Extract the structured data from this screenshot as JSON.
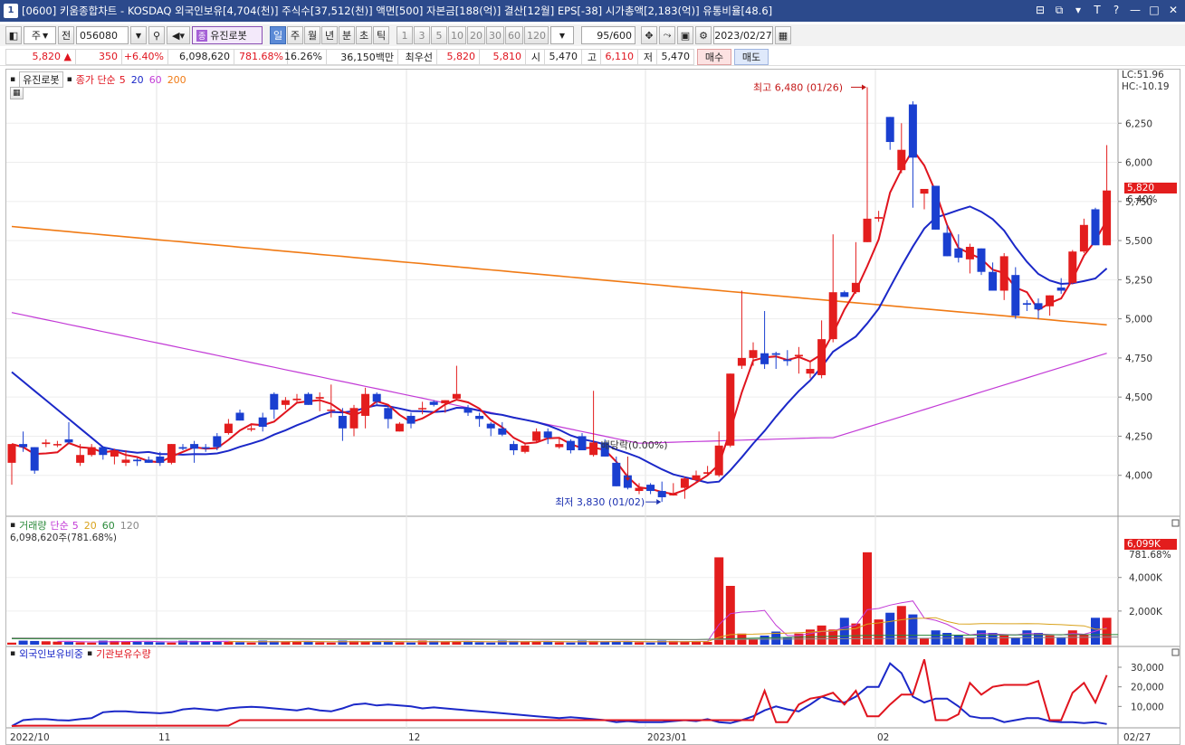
{
  "window": {
    "screen_id": "1",
    "title": "[0600] 키움종합차트 - KOSDAQ 외국인보유[4,704(천)] 주식수[37,512(천)] 액면[500] 자본금[188(억)] 결산[12월] EPS[-38] 시가총액[2,183(억)] 유통비율[48.6]",
    "buttons": [
      "⊟",
      "⧉",
      "▾",
      "T",
      "?",
      "—",
      "□",
      "✕"
    ]
  },
  "toolbar": {
    "period_select": "주",
    "prev_label": "전",
    "code": "056080",
    "stock_name_badge": "종",
    "stock_name": "유진로봇",
    "period_tabs": [
      "일",
      "주",
      "월",
      "년",
      "분",
      "초",
      "틱"
    ],
    "active_period": "일",
    "intervals": [
      "1",
      "3",
      "5",
      "10",
      "20",
      "30",
      "60",
      "120"
    ],
    "count": "95",
    "count_total": "/600",
    "date": "2023/02/27"
  },
  "quote": {
    "price": "5,820",
    "arrow": "▲",
    "change": "350",
    "change_pct": "+6.40%",
    "volume": "6,098,620",
    "volume_pct": "781.68%",
    "turnover": "16.26%",
    "amount": "36,150백만",
    "best_label": "최우선",
    "ask": "5,820",
    "bid": "5,810",
    "open_label": "시",
    "open": "5,470",
    "high_label": "고",
    "high": "6,110",
    "low_label": "저",
    "low": "5,470",
    "buy_label": "매수",
    "sell_label": "매도"
  },
  "price_panel": {
    "stock_label": "유진로봇",
    "ma_label": "종가 단순",
    "ma_periods": [
      "5",
      "20",
      "60",
      "200"
    ],
    "ma_colors": [
      "#e0141e",
      "#1b28c8",
      "#c23ad6",
      "#f07a14"
    ],
    "lc": "LC:51.96",
    "hc": "HC:-10.19",
    "y_ticks": [
      "6,250",
      "6,000",
      "5,750",
      "5,500",
      "5,250",
      "5,000",
      "4,750",
      "4,500",
      "4,250",
      "4,000"
    ],
    "current_price": "5,820",
    "current_pct": "6.40%",
    "high_annotation": "최고 6,480 (01/26)",
    "low_annotation": "최저 3,830 (01/02)",
    "dividend_annotation": "배당락(0.00%)"
  },
  "volume_panel": {
    "label": "거래량",
    "ma_label": "단순",
    "ma_periods": [
      "5",
      "20",
      "60",
      "120"
    ],
    "ma_colors": [
      "#c23ad6",
      "#d9a21b",
      "#2a8a3a",
      "#888888"
    ],
    "value": "6,098,620주(781.68%)",
    "y_ticks": [
      "4,000K",
      "2,000K"
    ],
    "current": "6,099K",
    "current_pct": "781.68%"
  },
  "foreign_panel": {
    "label1": "외국인보유비중",
    "label2": "기관보유수량",
    "y_ticks": [
      "30,000",
      "20,000",
      "10,000"
    ]
  },
  "x_axis": [
    "2022/10",
    "11",
    "12",
    "2023/01",
    "02",
    "02/27"
  ],
  "chart_data": {
    "type": "candlestick",
    "ohlc": [
      [
        4080,
        4200,
        3940,
        4200
      ],
      [
        4200,
        4280,
        4150,
        4180
      ],
      [
        4180,
        4180,
        4010,
        4030
      ],
      [
        4200,
        4230,
        4180,
        4210
      ],
      [
        4200,
        4220,
        4180,
        4200
      ],
      [
        4230,
        4340,
        4200,
        4210
      ],
      [
        4080,
        4200,
        4060,
        4130
      ],
      [
        4130,
        4200,
        4120,
        4180
      ],
      [
        4180,
        4180,
        4100,
        4130
      ],
      [
        4120,
        4170,
        4070,
        4160
      ],
      [
        4080,
        4160,
        4060,
        4100
      ],
      [
        4100,
        4110,
        4060,
        4090
      ],
      [
        4100,
        4120,
        4080,
        4080
      ],
      [
        4120,
        4150,
        4060,
        4080
      ],
      [
        4080,
        4200,
        4070,
        4200
      ],
      [
        4180,
        4200,
        4160,
        4170
      ],
      [
        4200,
        4220,
        4080,
        4170
      ],
      [
        4180,
        4200,
        4150,
        4170
      ],
      [
        4250,
        4270,
        4160,
        4180
      ],
      [
        4270,
        4360,
        4260,
        4330
      ],
      [
        4400,
        4420,
        4350,
        4350
      ],
      [
        4300,
        4320,
        4280,
        4300
      ],
      [
        4370,
        4400,
        4280,
        4310
      ],
      [
        4520,
        4530,
        4360,
        4420
      ],
      [
        4450,
        4500,
        4420,
        4480
      ],
      [
        4480,
        4520,
        4460,
        4490
      ],
      [
        4520,
        4530,
        4460,
        4450
      ],
      [
        4490,
        4530,
        4410,
        4500
      ],
      [
        4420,
        4580,
        4370,
        4420
      ],
      [
        4380,
        4430,
        4220,
        4300
      ],
      [
        4300,
        4450,
        4250,
        4430
      ],
      [
        4380,
        4560,
        4300,
        4520
      ],
      [
        4520,
        4530,
        4450,
        4470
      ],
      [
        4430,
        4440,
        4300,
        4360
      ],
      [
        4280,
        4340,
        4280,
        4330
      ],
      [
        4380,
        4400,
        4300,
        4330
      ],
      [
        4430,
        4470,
        4390,
        4430
      ],
      [
        4470,
        4480,
        4440,
        4450
      ],
      [
        4460,
        4470,
        4400,
        4480
      ],
      [
        4490,
        4700,
        4480,
        4520
      ],
      [
        4430,
        4450,
        4380,
        4400
      ],
      [
        4380,
        4400,
        4310,
        4360
      ],
      [
        4330,
        4340,
        4250,
        4300
      ],
      [
        4300,
        4340,
        4250,
        4260
      ],
      [
        4200,
        4220,
        4130,
        4160
      ],
      [
        4150,
        4200,
        4140,
        4190
      ],
      [
        4220,
        4300,
        4210,
        4280
      ],
      [
        4280,
        4300,
        4200,
        4240
      ],
      [
        4180,
        4240,
        4170,
        4200
      ],
      [
        4220,
        4230,
        4140,
        4160
      ],
      [
        4250,
        4270,
        4160,
        4160
      ],
      [
        4130,
        4540,
        4120,
        4210
      ],
      [
        4210,
        4230,
        4130,
        4120
      ],
      [
        4080,
        4120,
        3930,
        3930
      ],
      [
        4000,
        4020,
        3910,
        3920
      ],
      [
        3900,
        3950,
        3880,
        3920
      ],
      [
        3940,
        3950,
        3880,
        3900
      ],
      [
        3900,
        3960,
        3830,
        3860
      ],
      [
        3880,
        3950,
        3870,
        3880
      ],
      [
        3920,
        3990,
        3850,
        3980
      ],
      [
        3970,
        4030,
        3960,
        4000
      ],
      [
        4010,
        4060,
        4000,
        4020
      ],
      [
        4000,
        4280,
        3990,
        4190
      ],
      [
        4190,
        4440,
        4180,
        4650
      ],
      [
        4700,
        5180,
        4680,
        4750
      ],
      [
        4750,
        4850,
        4700,
        4800
      ],
      [
        4780,
        5050,
        4680,
        4710
      ],
      [
        4780,
        4790,
        4680,
        4770
      ],
      [
        4740,
        4800,
        4700,
        4730
      ],
      [
        4760,
        4820,
        4650,
        4770
      ],
      [
        4650,
        4730,
        4620,
        4680
      ],
      [
        4640,
        4990,
        4620,
        4870
      ],
      [
        4870,
        5540,
        4850,
        5170
      ],
      [
        5170,
        5180,
        5150,
        5140
      ],
      [
        5170,
        5490,
        5160,
        5230
      ],
      [
        5490,
        6480,
        5520,
        5640
      ],
      [
        5640,
        5690,
        5620,
        5650
      ],
      [
        6290,
        6240,
        6080,
        6130
      ],
      [
        5950,
        6250,
        5930,
        6080
      ],
      [
        6370,
        6390,
        5710,
        6030
      ],
      [
        5800,
        5820,
        5700,
        5830
      ],
      [
        5850,
        5780,
        5620,
        5570
      ],
      [
        5550,
        5600,
        5470,
        5400
      ],
      [
        5450,
        5540,
        5360,
        5390
      ],
      [
        5380,
        5480,
        5290,
        5460
      ],
      [
        5450,
        5440,
        5280,
        5300
      ],
      [
        5300,
        5360,
        5180,
        5180
      ],
      [
        5180,
        5420,
        5120,
        5400
      ],
      [
        5280,
        5330,
        5000,
        5020
      ],
      [
        5100,
        5120,
        5050,
        5090
      ],
      [
        5100,
        5130,
        5000,
        5060
      ],
      [
        5080,
        5130,
        5020,
        5150
      ],
      [
        5200,
        5260,
        5160,
        5180
      ],
      [
        5230,
        5440,
        5220,
        5430
      ],
      [
        5430,
        5640,
        5420,
        5600
      ],
      [
        5700,
        5710,
        5490,
        5470
      ],
      [
        5470,
        6110,
        5470,
        5820
      ]
    ]
  }
}
